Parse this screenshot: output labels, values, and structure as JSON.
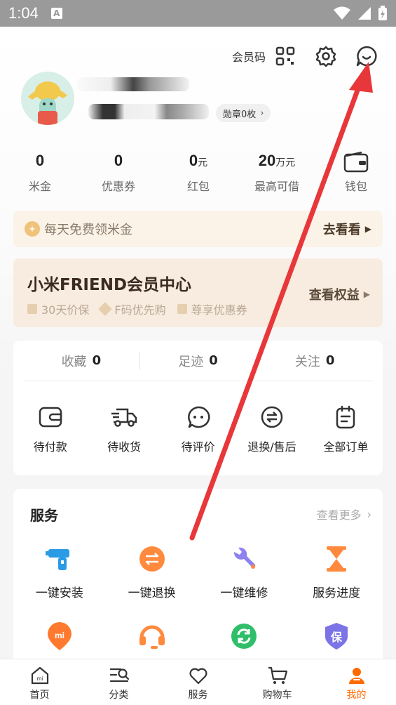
{
  "status_bar": {
    "time": "1:04",
    "indicator": "A"
  },
  "header": {
    "member_code_label": "会员码"
  },
  "profile": {
    "badge_label": "勋章0枚"
  },
  "stats": [
    {
      "value": "0",
      "unit": "",
      "label": "米金"
    },
    {
      "value": "0",
      "unit": "",
      "label": "优惠券"
    },
    {
      "value": "0",
      "unit": "元",
      "label": "红包"
    },
    {
      "value": "20",
      "unit": "万元",
      "label": "最高可借"
    },
    {
      "value": "",
      "unit": "",
      "label": "钱包"
    }
  ],
  "coin_banner": {
    "text": "每天免费领米金",
    "action": "去看看"
  },
  "member_card": {
    "title": "小米FRIEND会员中心",
    "perks": [
      "30天价保",
      "F码优先购",
      "尊享优惠券"
    ],
    "action": "查看权益"
  },
  "orders": {
    "tabs": [
      {
        "label": "收藏",
        "count": "0"
      },
      {
        "label": "足迹",
        "count": "0"
      },
      {
        "label": "关注",
        "count": "0"
      }
    ],
    "items": [
      {
        "label": "待付款",
        "icon": "wallet-icon"
      },
      {
        "label": "待收货",
        "icon": "truck-icon"
      },
      {
        "label": "待评价",
        "icon": "comment-icon"
      },
      {
        "label": "退换/售后",
        "icon": "exchange-icon"
      },
      {
        "label": "全部订单",
        "icon": "order-list-icon"
      }
    ]
  },
  "service": {
    "title": "服务",
    "more": "查看更多",
    "items": [
      {
        "label": "一键安装",
        "icon": "drill-icon",
        "color": "#2b9be6"
      },
      {
        "label": "一键退换",
        "icon": "swap-icon",
        "color": "#ff8a3d"
      },
      {
        "label": "一键维修",
        "icon": "wrench-icon",
        "color": "#8e82f0"
      },
      {
        "label": "服务进度",
        "icon": "hourglass-icon",
        "color": "#ff8a3d"
      }
    ],
    "row2_icons": [
      {
        "icon": "mi-pin-icon",
        "color": "#ff7a2e"
      },
      {
        "icon": "headset-icon",
        "color": "#ff8a3d"
      },
      {
        "icon": "refresh-icon",
        "color": "#2fbf6a"
      },
      {
        "icon": "shield-icon",
        "color": "#7b73e6",
        "glyph": "保"
      }
    ]
  },
  "bottom_nav": [
    {
      "label": "首页",
      "icon": "home-icon"
    },
    {
      "label": "分类",
      "icon": "category-icon"
    },
    {
      "label": "服务",
      "icon": "heart-icon"
    },
    {
      "label": "购物车",
      "icon": "cart-icon"
    },
    {
      "label": "我的",
      "icon": "profile-icon",
      "active": true
    }
  ],
  "accent_color": "#ff6900"
}
